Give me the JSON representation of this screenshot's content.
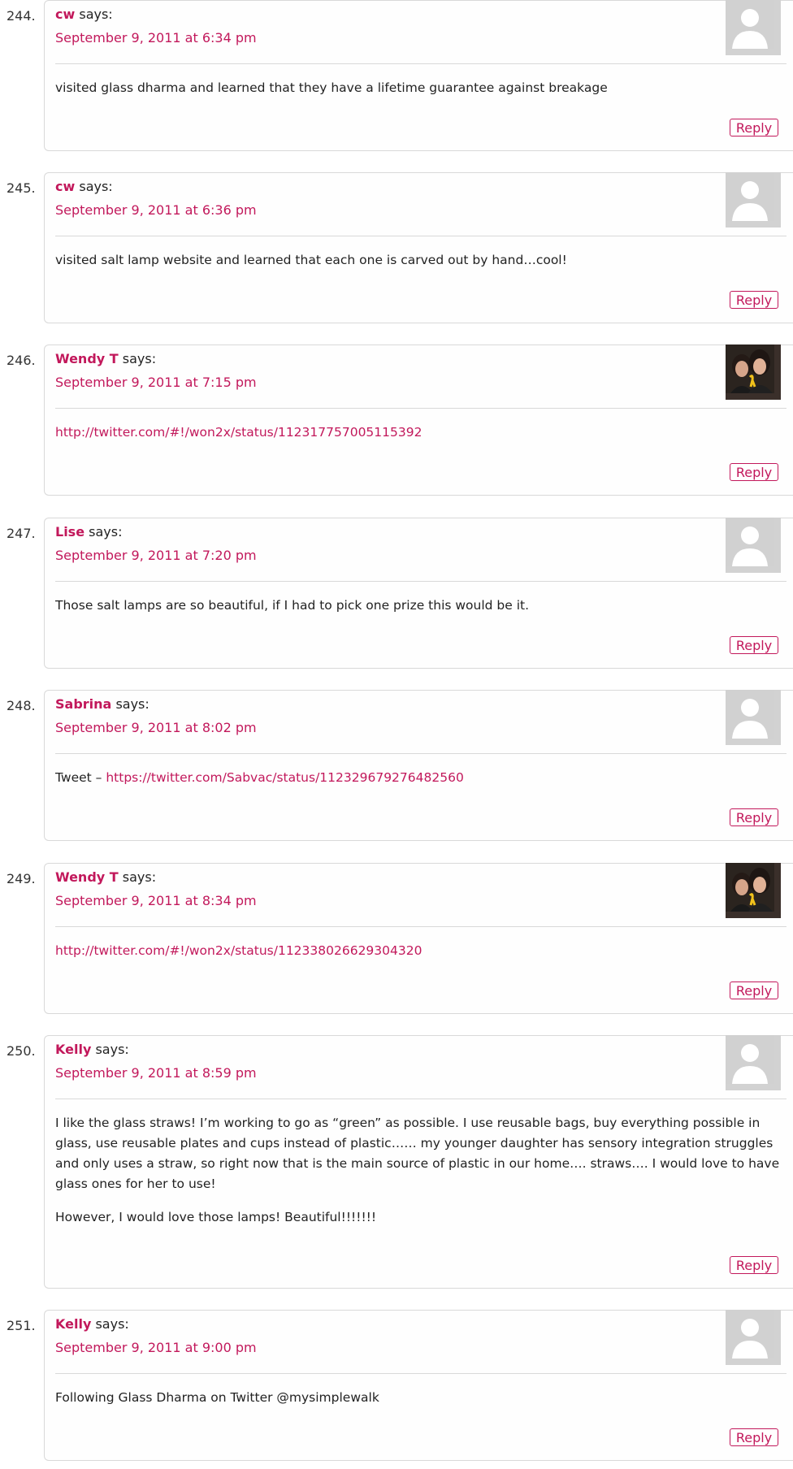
{
  "says_label": "says:",
  "reply_label": "Reply",
  "comments": [
    {
      "number": "244.",
      "author": "cw",
      "date": "September 9, 2011 at 6:34 pm",
      "avatar": "default-avatar",
      "paragraphs": [
        {
          "text": "visited glass dharma and learned that they have a lifetime guarantee against breakage"
        }
      ]
    },
    {
      "number": "245.",
      "author": "cw",
      "date": "September 9, 2011 at 6:36 pm",
      "avatar": "default-avatar",
      "paragraphs": [
        {
          "text": "visited salt lamp website and learned that each one is carved out by hand…cool!"
        }
      ]
    },
    {
      "number": "246.",
      "author": "Wendy T",
      "date": "September 9, 2011 at 7:15 pm",
      "avatar": "photo-avatar",
      "paragraphs": [
        {
          "link": "http://twitter.com/#!/won2x/status/112317757005115392"
        }
      ]
    },
    {
      "number": "247.",
      "author": "Lise",
      "date": "September 9, 2011 at 7:20 pm",
      "avatar": "default-avatar",
      "paragraphs": [
        {
          "text": "Those salt lamps are so beautiful, if I had to pick one prize this would be it."
        }
      ]
    },
    {
      "number": "248.",
      "author": "Sabrina",
      "date": "September 9, 2011 at 8:02 pm",
      "avatar": "default-avatar",
      "paragraphs": [
        {
          "text": "Tweet – ",
          "link": "https://twitter.com/Sabvac/status/112329679276482560"
        }
      ]
    },
    {
      "number": "249.",
      "author": "Wendy T",
      "date": "September 9, 2011 at 8:34 pm",
      "avatar": "photo-avatar",
      "paragraphs": [
        {
          "link": "http://twitter.com/#!/won2x/status/112338026629304320"
        }
      ]
    },
    {
      "number": "250.",
      "author": "Kelly",
      "date": "September 9, 2011 at 8:59 pm",
      "avatar": "default-avatar",
      "paragraphs": [
        {
          "text": "I like the glass straws! I’m working to go as “green” as possible. I use reusable bags, buy everything possible in glass, use reusable plates and cups instead of plastic…… my younger daughter has sensory integration struggles and only uses a straw, so right now that is the main source of plastic in our home…. straws…. I would love to have glass ones for her to use!"
        },
        {
          "text": "However, I would love those lamps! Beautiful!!!!!!!"
        }
      ]
    },
    {
      "number": "251.",
      "author": "Kelly",
      "date": "September 9, 2011 at 9:00 pm",
      "avatar": "default-avatar",
      "paragraphs": [
        {
          "text": "Following Glass Dharma on Twitter @mysimplewalk"
        }
      ]
    }
  ]
}
